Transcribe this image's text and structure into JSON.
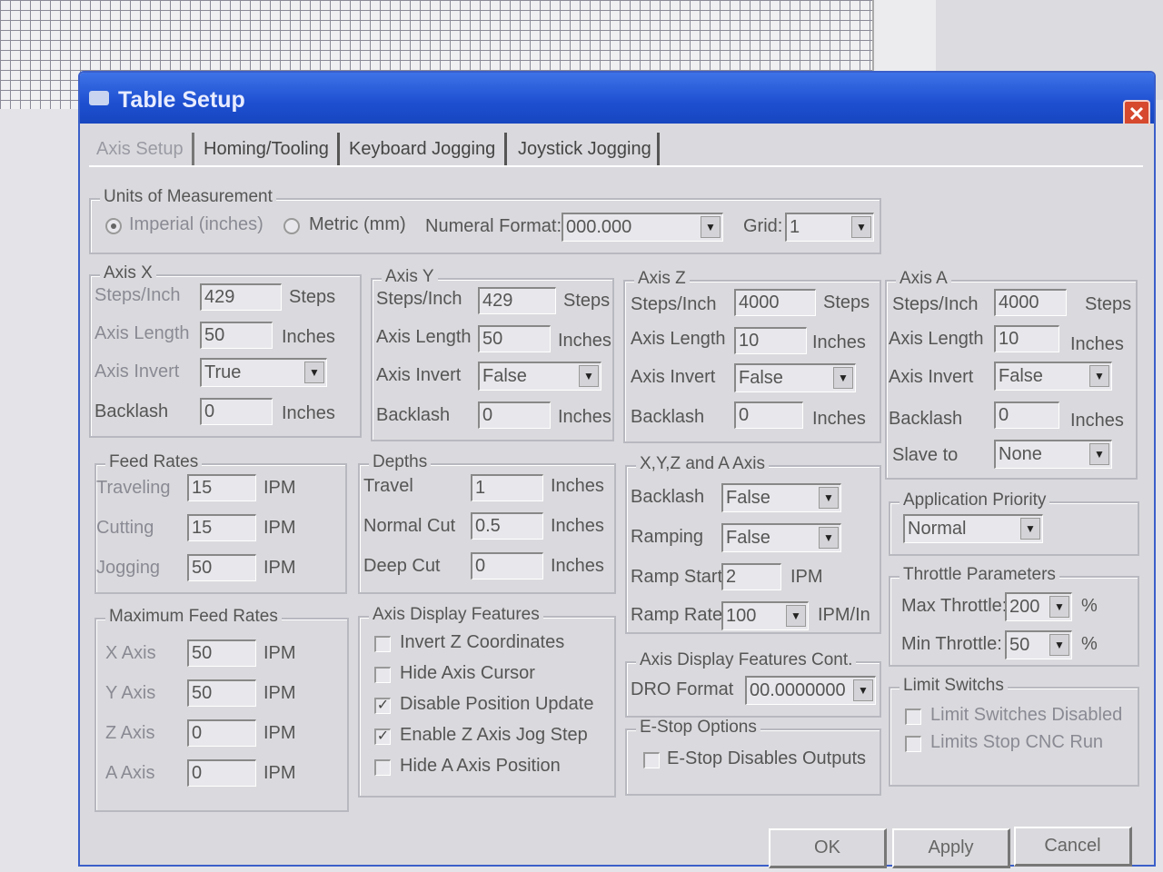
{
  "window": {
    "title": "Table Setup",
    "close": "✕"
  },
  "tabs": [
    {
      "label": "Axis Setup"
    },
    {
      "label": "Homing/Tooling"
    },
    {
      "label": "Keyboard Jogging"
    },
    {
      "label": "Joystick Jogging"
    }
  ],
  "units": {
    "title": "Units of Measurement",
    "imperial_label": "Imperial (inches)",
    "metric_label": "Metric (mm)",
    "selected": "Imperial (inches)",
    "numeral_format_label": "Numeral Format:",
    "numeral_format_value": "000.000",
    "grid_label": "Grid:",
    "grid_value": "1"
  },
  "labels": {
    "steps_per_inch": "Steps/Inch",
    "axis_length": "Axis Length",
    "axis_invert": "Axis Invert",
    "backlash": "Backlash",
    "steps": "Steps",
    "inches": "Inches",
    "ipm": "IPM",
    "ipm_in": "IPM/In",
    "percent": "%",
    "slave_to": "Slave to"
  },
  "axis_x": {
    "title": "Axis X",
    "steps": "429",
    "length": "50",
    "invert": "True",
    "backlash": "0"
  },
  "axis_y": {
    "title": "Axis Y",
    "steps": "429",
    "length": "50",
    "invert": "False",
    "backlash": "0"
  },
  "axis_z": {
    "title": "Axis Z",
    "steps": "4000",
    "length": "10",
    "invert": "False",
    "backlash": "0"
  },
  "axis_a": {
    "title": "Axis A",
    "steps": "4000",
    "length": "10",
    "invert": "False",
    "backlash": "0",
    "slave_to": "None"
  },
  "feed_rates": {
    "title": "Feed Rates",
    "traveling_label": "Traveling",
    "traveling": "15",
    "cutting_label": "Cutting",
    "cutting": "15",
    "jogging_label": "Jogging",
    "jogging": "50"
  },
  "depths": {
    "title": "Depths",
    "travel_label": "Travel",
    "travel": "1",
    "normal_label": "Normal Cut",
    "normal": "0.5",
    "deep_label": "Deep Cut",
    "deep": "0"
  },
  "xyza": {
    "title": "X,Y,Z and A Axis",
    "backlash_label": "Backlash",
    "backlash": "False",
    "ramping_label": "Ramping",
    "ramping": "False",
    "ramp_start_label": "Ramp Start",
    "ramp_start": "2",
    "ramp_rate_label": "Ramp Rate",
    "ramp_rate": "100"
  },
  "max_feed": {
    "title": "Maximum Feed Rates",
    "x_label": "X Axis",
    "x": "50",
    "y_label": "Y Axis",
    "y": "50",
    "z_label": "Z Axis",
    "z": "0",
    "a_label": "A Axis",
    "a": "0"
  },
  "display": {
    "title": "Axis Display Features",
    "items": [
      {
        "label": "Invert Z Coordinates",
        "checked": false
      },
      {
        "label": "Hide Axis Cursor",
        "checked": false
      },
      {
        "label": "Disable Position Update",
        "checked": true
      },
      {
        "label": "Enable Z Axis Jog Step",
        "checked": true
      },
      {
        "label": "Hide A Axis Position",
        "checked": false
      }
    ]
  },
  "display_cont": {
    "title": "Axis Display Features Cont.",
    "dro_label": "DRO Format",
    "dro": "00.0000000"
  },
  "estop": {
    "title": "E-Stop Options",
    "item": "E-Stop Disables Outputs",
    "checked": false
  },
  "priority": {
    "title": "Application Priority",
    "value": "Normal"
  },
  "throttle": {
    "title": "Throttle Parameters",
    "max_label": "Max Throttle:",
    "max": "200",
    "min_label": "Min Throttle:",
    "min": "50"
  },
  "limits": {
    "title": "Limit Switchs",
    "items": [
      {
        "label": "Limit Switches Disabled",
        "checked": false
      },
      {
        "label": "Limits Stop CNC Run",
        "checked": false
      }
    ]
  },
  "buttons": {
    "ok": "OK",
    "apply": "Apply",
    "cancel": "Cancel"
  },
  "arrow": "▼",
  "check": "✓"
}
